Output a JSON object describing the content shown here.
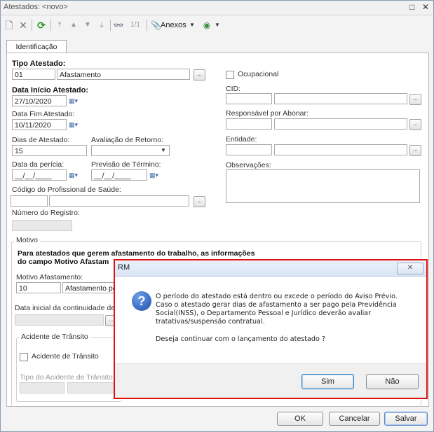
{
  "window": {
    "title": "Atestados: <novo>",
    "restore_glyph": "□",
    "close_glyph": "✕"
  },
  "toolbar": {
    "record_counter": "1/1",
    "anexos_label": "Anexos",
    "icons": [
      "new-icon",
      "delete-icon",
      "refresh-icon",
      "first-icon",
      "prev-icon",
      "next-icon",
      "last-icon",
      "search-icon",
      "attachment-icon",
      "globe-icon"
    ]
  },
  "tab": {
    "label": "Identificação"
  },
  "form": {
    "tipo_atestado_label": "Tipo Atestado:",
    "tipo_atestado_code": "01",
    "tipo_atestado_desc": "Afastamento",
    "ocupacional_label": "Ocupacional",
    "data_inicio_label": "Data Início Atestado:",
    "data_inicio_value": "27/10/2020",
    "cid_label": "CID:",
    "data_fim_label": "Data Fim Atestado:",
    "data_fim_value": "10/11/2020",
    "responsavel_label": "Responsável por Abonar:",
    "dias_label": "Dias de Atestado:",
    "dias_value": "15",
    "avaliacao_label": "Avaliação de Retorno:",
    "entidade_label": "Entidade:",
    "data_pericia_label": "Data da perícia:",
    "data_pericia_value": "__/__/____",
    "previsao_label": "Previsão de Término:",
    "previsao_value": "__/__/____",
    "observacoes_label": "Observações:",
    "codigo_prof_label": "Código do Profissional de Saúde:",
    "numero_registro_label": "Número do Registro:",
    "motivo_group_label": "Motivo",
    "motivo_info_line1": "Para atestados que gerem afastamento do trabalho, as informações",
    "motivo_info_line2": "do campo Motivo Afastam",
    "motivo_afast_label": "Motivo Afastamento:",
    "motivo_afast_code": "10",
    "motivo_afast_desc": "Afastamento po",
    "data_continuidade_label": "Data inicial da continuidade de A",
    "acidente_group_label": "Acidente de Trânsito",
    "acidente_chk_label": "Acidente de Trânsito",
    "tipo_acidente_label": "Tipo do Acidente de Trânsito:",
    "browse_glyph": "...",
    "dropdown_glyph": "▼"
  },
  "footer": {
    "ok": "OK",
    "cancel": "Cancelar",
    "save": "Salvar"
  },
  "dialog": {
    "title": "RM",
    "close_glyph": "✕",
    "message_lines": [
      "O período do atestado está dentro ou excede o período do Aviso Prévio.",
      "Caso o atestado gerar dias de afastamento a ser pago pela Previdência",
      "Social(INSS), o Departamento Pessoal e Jurídico deverão avaliar",
      "tratativas/suspensão contratual."
    ],
    "question": "Deseja continuar com o lançamento do atestado ?",
    "yes": "Sim",
    "no": "Não"
  }
}
